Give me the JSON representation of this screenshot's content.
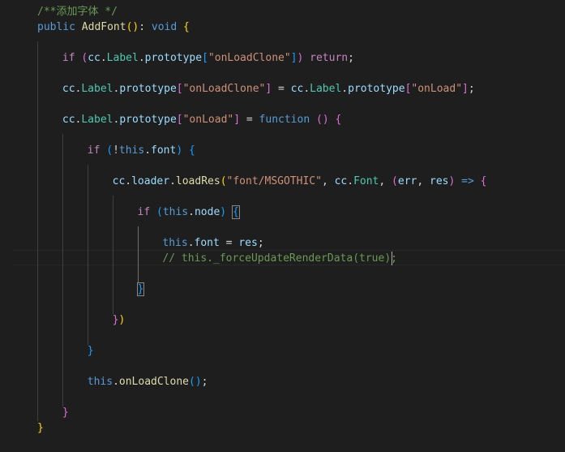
{
  "editor": {
    "theme_colors": {
      "background": "#1e1e1e",
      "keyword": "#569cd6",
      "control": "#c586c0",
      "function": "#dcdcaa",
      "string": "#ce9178",
      "variable": "#9cdcfe",
      "type": "#4ec9b0",
      "comment": "#6a9955",
      "bracket_1": "#ffd700",
      "bracket_2": "#da70d6",
      "bracket_3": "#179fff"
    },
    "lines": [
      "/**添加字体 */",
      "public AddFont(): void {",
      "",
      "    if (cc.Label.prototype[\"onLoadClone\"]) return;",
      "",
      "    cc.Label.prototype[\"onLoadClone\"] = cc.Label.prototype[\"onLoad\"];",
      "",
      "    cc.Label.prototype[\"onLoad\"] = function () {",
      "",
      "        if (!this.font) {",
      "",
      "            cc.loader.loadRes(\"font/MSGOTHIC\", cc.Font, (err, res) => {",
      "",
      "                if (this.node) {",
      "",
      "                    this.font = res;",
      "                    // this._forceUpdateRenderData(true);",
      "",
      "                }",
      "",
      "            })",
      "",
      "        }",
      "",
      "        this.onLoadClone();",
      "",
      "    }",
      "}"
    ]
  }
}
